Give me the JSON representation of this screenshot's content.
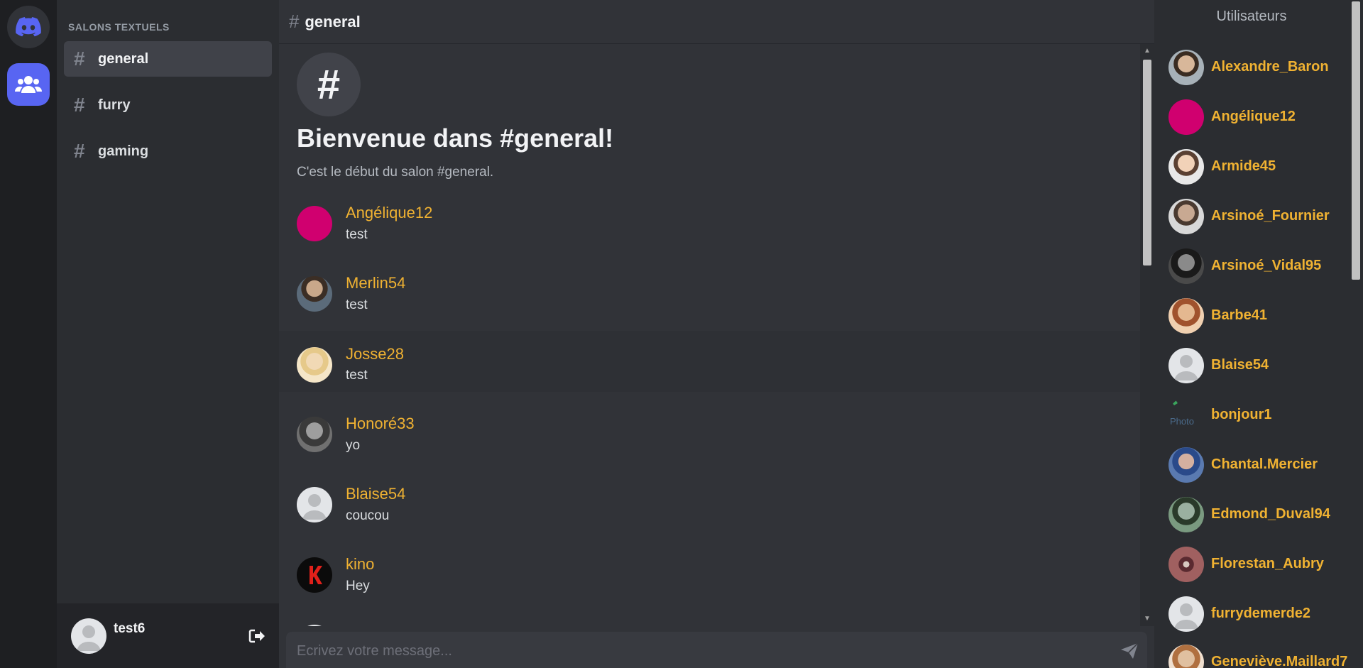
{
  "channels_panel": {
    "category": "SALONS TEXTUELS",
    "channels": [
      {
        "name": "general",
        "active": true
      },
      {
        "name": "furry",
        "active": false
      },
      {
        "name": "gaming",
        "active": false
      }
    ]
  },
  "current_user": {
    "name": "test6"
  },
  "header": {
    "channel_name": "general"
  },
  "welcome": {
    "icon": "#",
    "title": "Bienvenue dans #general!",
    "subtitle": "C'est le début du salon #general."
  },
  "messages": [
    {
      "author": "Angélique12",
      "text": "test"
    },
    {
      "author": "Merlin54",
      "text": "test"
    },
    {
      "author": "Josse28",
      "text": "test"
    },
    {
      "author": "Honoré33",
      "text": "yo"
    },
    {
      "author": "Blaise54",
      "text": "coucou"
    },
    {
      "author": "kino",
      "text": "Hey"
    }
  ],
  "composer": {
    "placeholder": "Ecrivez votre message..."
  },
  "members_panel": {
    "title": "Utilisateurs",
    "members": [
      "Alexandre_Baron",
      "Angélique12",
      "Armide45",
      "Arsinoé_Fournier",
      "Arsinoé_Vidal95",
      "Barbe41",
      "Blaise54",
      "bonjour1",
      "Chantal.Mercier",
      "Edmond_Duval94",
      "Florestan_Aubry",
      "furrydemerde2",
      "Geneviève.Maillard7"
    ],
    "broken_avatar_alt": "Photo"
  },
  "colors": {
    "accent": "#5865f2",
    "username": "#f0b232",
    "pink_avatar": "#d0006f"
  }
}
